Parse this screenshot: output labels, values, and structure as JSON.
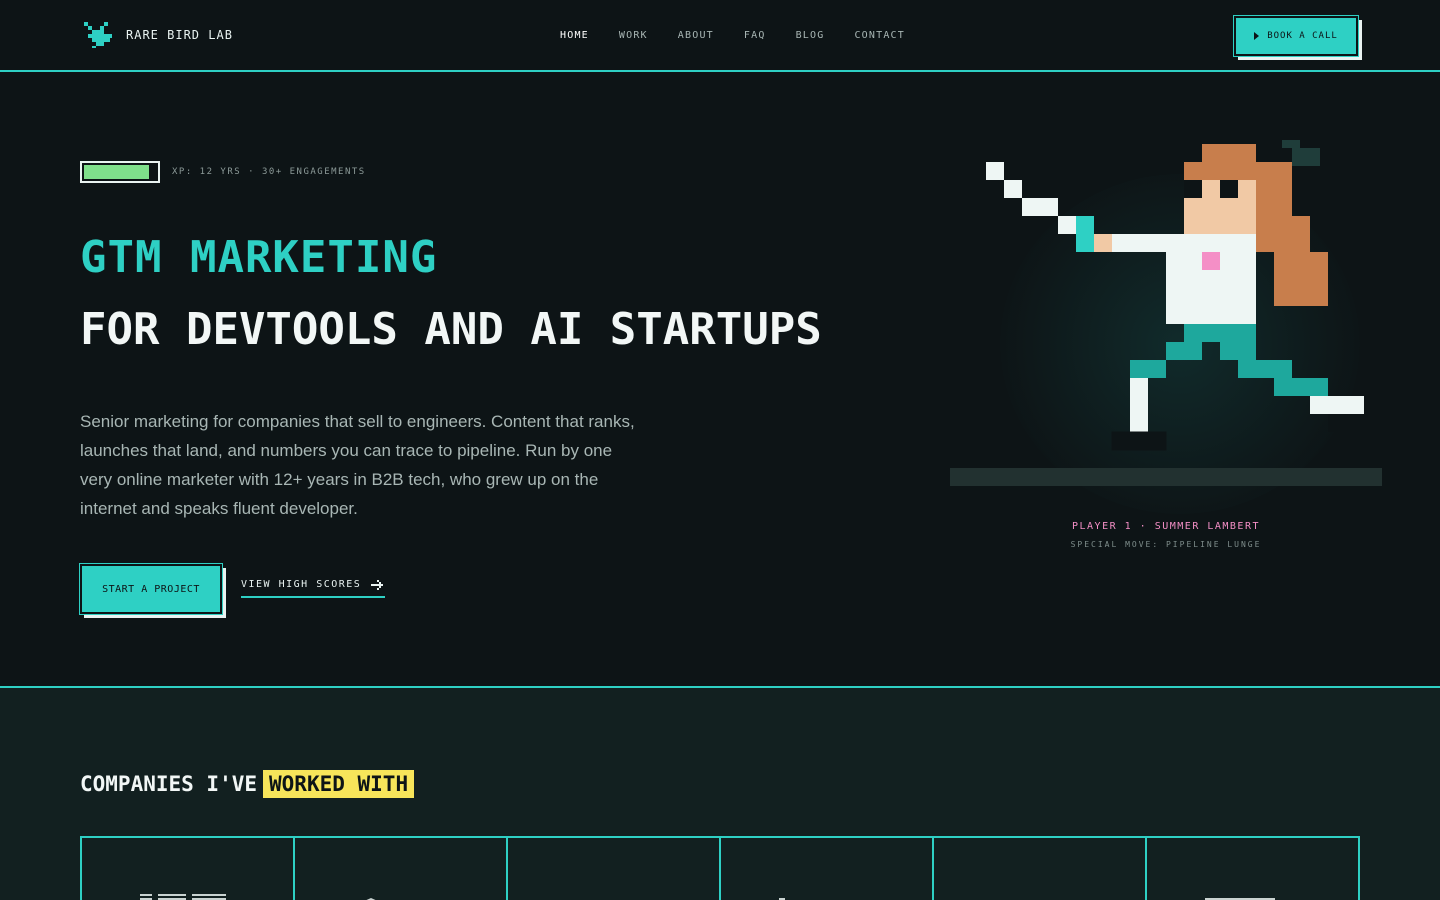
{
  "brand": {
    "name": "RARE BIRD LAB"
  },
  "nav": {
    "links": [
      "HOME",
      "WORK",
      "ABOUT",
      "FAQ",
      "BLOG",
      "CONTACT"
    ],
    "cta_label": "BOOK A CALL"
  },
  "hero": {
    "xp_level": 0.9,
    "xp_text": "XP: 12 YRS · 30+ ENGAGEMENTS",
    "headline_line1": "GTM MARKETING",
    "headline_line2": "FOR DEVTOOLS AND AI STARTUPS",
    "lead": "Senior marketing for companies that sell to engineers. Content that ranks, launches that land, and numbers you can trace to pipeline. Run by one very online marketer with 12+ years in B2B tech, who grew up on the internet and speaks fluent developer.",
    "primary_cta": "START A PROJECT",
    "secondary_cta": "VIEW HIGH SCORES",
    "player_label": "PLAYER 1 · SUMMER LAMBERT",
    "special_move": "SPECIAL MOVE: PIPELINE LUNGE"
  },
  "companies": {
    "title_prefix": "COMPANIES I'VE",
    "title_highlight": "WORKED WITH",
    "logos": [
      "ibm-logo",
      "company-logo-2",
      "company-logo-3",
      "company-logo-4",
      "company-logo-5",
      "company-logo-6"
    ]
  },
  "colors": {
    "accent": "#2ed0c4",
    "background": "#0d1416",
    "highlight": "#f7e55a",
    "pink": "#f48fc6",
    "xp_green": "#7fe08b"
  }
}
